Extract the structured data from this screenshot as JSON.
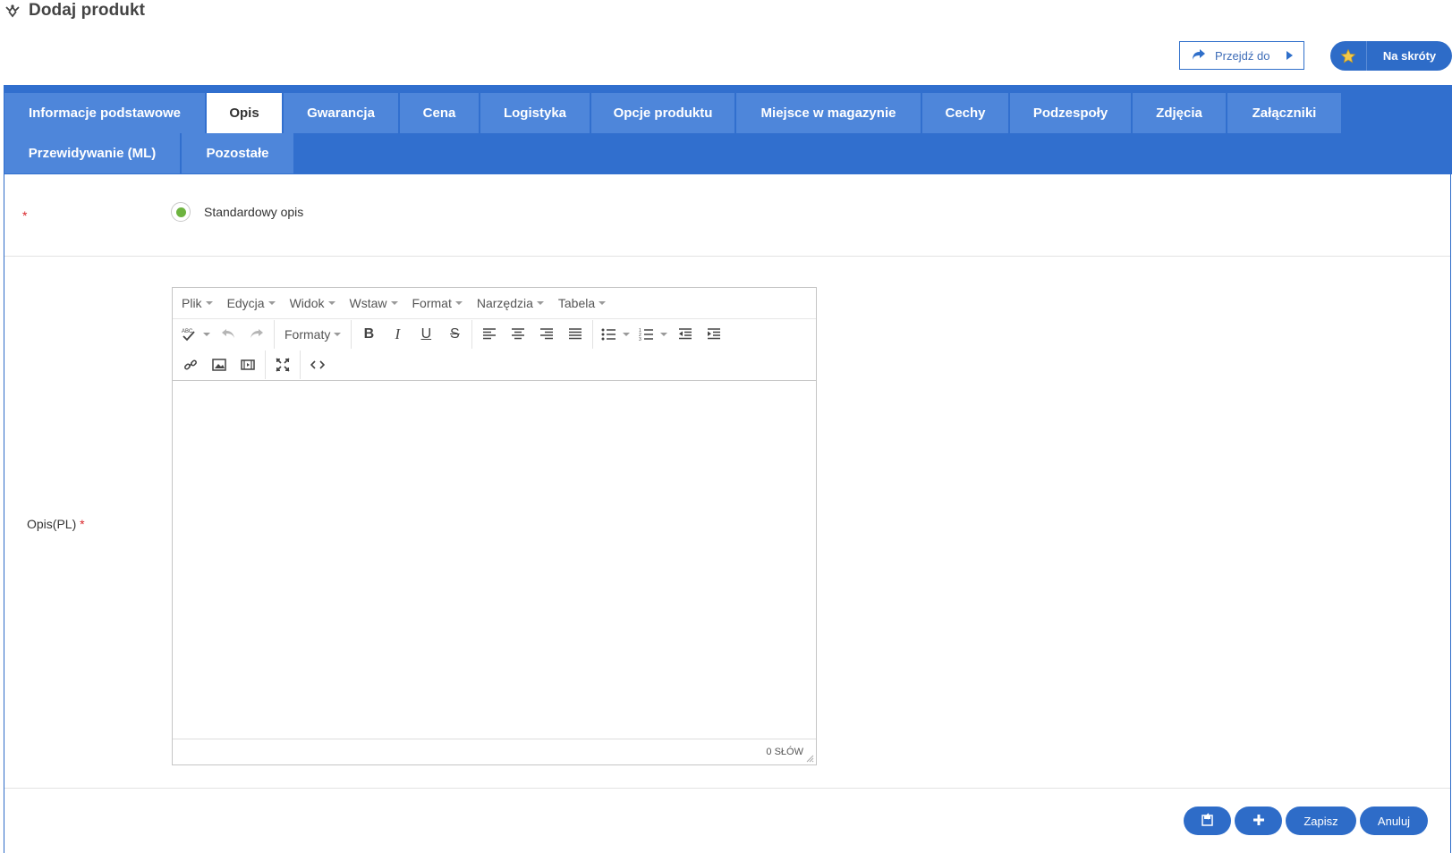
{
  "header": {
    "title": "Dodaj produkt"
  },
  "actions": {
    "goto_label": "Przejdź do",
    "shortcuts_label": "Na skróty"
  },
  "tabs": {
    "row1": [
      {
        "label": "Informacje podstawowe",
        "active": false
      },
      {
        "label": "Opis",
        "active": true
      },
      {
        "label": "Gwarancja",
        "active": false
      },
      {
        "label": "Cena",
        "active": false
      },
      {
        "label": "Logistyka",
        "active": false
      },
      {
        "label": "Opcje produktu",
        "active": false
      },
      {
        "label": "Miejsce w magazynie",
        "active": false
      },
      {
        "label": "Cechy",
        "active": false
      },
      {
        "label": "Podzespoły",
        "active": false
      },
      {
        "label": "Zdjęcia",
        "active": false
      },
      {
        "label": "Załączniki",
        "active": false
      }
    ],
    "row2": [
      {
        "label": "Przewidywanie (ML)",
        "active": false
      },
      {
        "label": "Pozostałe",
        "active": false
      }
    ]
  },
  "form": {
    "description_type": {
      "required_mark": "*",
      "option_label": "Standardowy opis",
      "selected": true
    },
    "description_pl": {
      "label": "Opis(PL)",
      "required_mark": "*"
    }
  },
  "editor": {
    "menus": [
      "Plik",
      "Edycja",
      "Widok",
      "Wstaw",
      "Format",
      "Narzędzia",
      "Tabela"
    ],
    "formats_label": "Formaty",
    "content": "",
    "word_count": "0 SŁÓW"
  },
  "footer": {
    "save_label": "Zapisz",
    "cancel_label": "Anuluj"
  },
  "colors": {
    "primary": "#2e6cc8",
    "tab_bg": "#4e86da",
    "radio_selected": "#6db33f",
    "required": "#d9262a"
  }
}
